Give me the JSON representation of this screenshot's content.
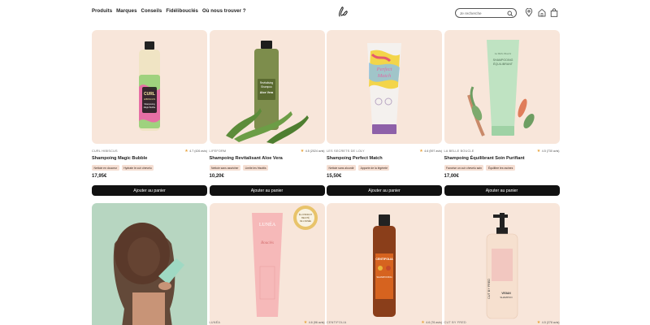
{
  "header": {
    "nav": [
      "Produits",
      "Marques",
      "Conseils",
      "Fidélibouclés",
      "Où nous trouver ?"
    ],
    "search_placeholder": "Je recherche"
  },
  "products": [
    {
      "brand": "Curl Hibiscus",
      "rating": "4.7 (426 avis)",
      "name": "Shampoing Magic Bubble",
      "tags": [
        "Nettoie en douceur",
        "Hydrate le cuir chevelu"
      ],
      "price": "17,95€",
      "button": "Ajouter au panier",
      "bottle_label": [
        "CURL",
        "HIBISCUS",
        "Shampooing",
        "Magic Bubble"
      ]
    },
    {
      "brand": "Lifeform",
      "rating": "4.5 (2024 avis)",
      "name": "Shampoing Revitalisant Aloe Vera",
      "tags": [
        "Nettoie sans assécher",
        "Limite les frisottis"
      ],
      "price": "10,20€",
      "button": "Ajouter au panier",
      "bottle_label": [
        "Revitalising",
        "Shampoo",
        "Aloe Vera"
      ]
    },
    {
      "brand": "Les secrets de Loly",
      "rating": "4.6 (597 avis)",
      "name": "Shampoing Perfect Match",
      "tags": [
        "Nettoie sans alourdir",
        "Apporte de la légèreté"
      ],
      "price": "15,50€",
      "button": "Ajouter au panier",
      "bottle_label": [
        "Perfect",
        "Match"
      ]
    },
    {
      "brand": "La belle boucle",
      "rating": "4.5 (730 avis)",
      "name": "Shampoing Équilibrant Soin Purifiant",
      "tags": [
        "Favorise un cuir chevelu sain",
        "Équilibre les racines"
      ],
      "price": "17,00€",
      "button": "Ajouter au panier",
      "bottle_label": [
        "La Belle Boucle",
        "SHAMPOOING",
        "ÉQUILIBRANT"
      ]
    }
  ],
  "row2": [
    {
      "brand": "",
      "rating": ""
    },
    {
      "brand": "Lunéa",
      "rating": "4.6 (96 avis)",
      "bottle_label": [
        "LUNÉA",
        "Bouclés"
      ],
      "badge": [
        "ÉLU PRODUIT",
        "BEAUTÉ",
        "DE L'ANNÉE"
      ]
    },
    {
      "brand": "Centifolia",
      "rating": "4.6 (76 avis)",
      "bottle_label": [
        "CENTIFOLIA",
        "SHAMPOOING"
      ]
    },
    {
      "brand": "Cut by Fred",
      "rating": "4.5 (278 avis)",
      "bottle_label": [
        "CUT BY FRED",
        "VEGAN",
        "SHAMPOO"
      ]
    }
  ],
  "colors": {
    "card_bg": "#f8e6da",
    "button_bg": "#111111",
    "accent_star": "#e8a33c"
  },
  "icons": [
    "logo-icon",
    "search-icon",
    "location-pin-icon",
    "home-icon",
    "bag-icon",
    "star-icon"
  ]
}
